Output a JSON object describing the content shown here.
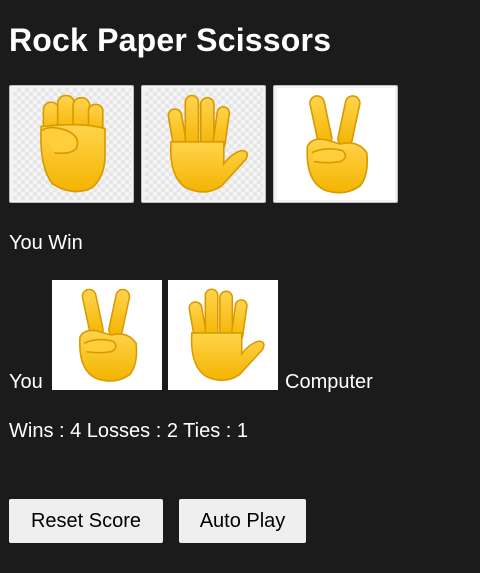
{
  "title": "Rock Paper Scissors",
  "moves": [
    {
      "name": "rock",
      "icon": "raised-fist-icon"
    },
    {
      "name": "paper",
      "icon": "raised-hand-icon"
    },
    {
      "name": "scissors",
      "icon": "victory-hand-icon"
    }
  ],
  "result": "You Win",
  "player_label": "You",
  "computer_label": "Computer",
  "player_move_icon": "victory-hand-icon",
  "computer_move_icon": "raised-hand-icon",
  "score_text": "Wins : 4 Losses : 2 Ties : 1",
  "buttons": {
    "reset": "Reset Score",
    "auto_play": "Auto Play"
  },
  "colors": {
    "background": "#1b1b1b",
    "text": "#ffffff",
    "emoji_yellow": "#ffc83d",
    "emoji_outline": "#e3a100"
  }
}
